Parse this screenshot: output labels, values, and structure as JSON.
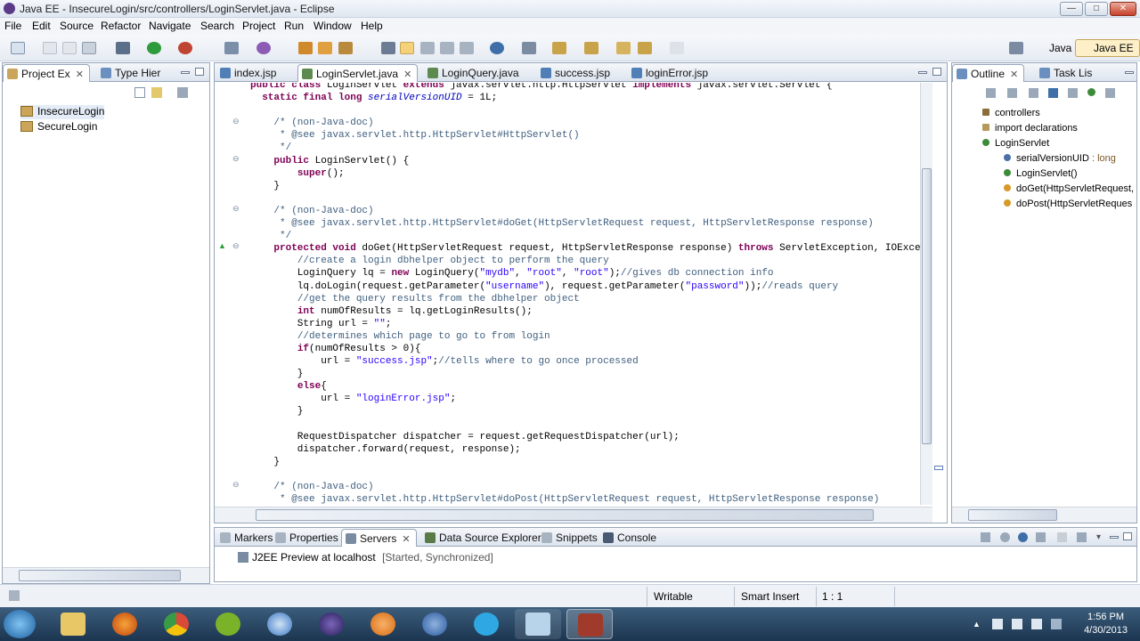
{
  "window": {
    "title": "Java EE - InsecureLogin/src/controllers/LoginServlet.java - Eclipse",
    "min": "—",
    "max": "□",
    "close": "✕"
  },
  "menu": [
    "File",
    "Edit",
    "Source",
    "Refactor",
    "Navigate",
    "Search",
    "Project",
    "Run",
    "Window",
    "Help"
  ],
  "perspectives": [
    {
      "label": "Java",
      "active": false
    },
    {
      "label": "Java EE",
      "active": true
    }
  ],
  "left_panel": {
    "tabs": [
      {
        "label": "Project Ex"
      },
      {
        "label": "Type Hier"
      }
    ],
    "projects": [
      "InsecureLogin",
      "SecureLogin"
    ]
  },
  "editor": {
    "tabs": [
      {
        "label": "index.jsp"
      },
      {
        "label": "LoginServlet.java"
      },
      {
        "label": "LoginQuery.java"
      },
      {
        "label": "success.jsp"
      },
      {
        "label": "loginError.jsp"
      }
    ],
    "selected_tab": 1
  },
  "outline": {
    "tabs": [
      {
        "label": "Outline"
      },
      {
        "label": "Task Lis"
      }
    ],
    "items": [
      {
        "label": "controllers",
        "indent": 0,
        "icon": "package-icon"
      },
      {
        "label": "import declarations",
        "indent": 0,
        "icon": "import-icon"
      },
      {
        "label": "LoginServlet",
        "indent": 0,
        "icon": "class-icon"
      },
      {
        "label": "serialVersionUID : long",
        "indent": 1,
        "icon": "field-icon"
      },
      {
        "label": "LoginServlet()",
        "indent": 1,
        "icon": "constructor-icon"
      },
      {
        "label": "doGet(HttpServletRequest,",
        "indent": 1,
        "icon": "method-icon"
      },
      {
        "label": "doPost(HttpServletReques",
        "indent": 1,
        "icon": "method-icon"
      }
    ]
  },
  "bottom_panel": {
    "tabs": [
      {
        "label": "Markers"
      },
      {
        "label": "Properties"
      },
      {
        "label": "Servers"
      },
      {
        "label": "Data Source Explorer"
      },
      {
        "label": "Snippets"
      },
      {
        "label": "Console"
      }
    ],
    "selected_tab": 2,
    "server_name": "J2EE Preview at localhost",
    "server_status": "[Started, Synchronized]"
  },
  "status": {
    "writable": "Writable",
    "insert": "Smart Insert",
    "position": "1 : 1"
  },
  "taskbar": {
    "time": "1:56 PM",
    "date": "4/30/2013"
  },
  "colors": {
    "keyword": "#7f0055",
    "comment": "#3f5f7f",
    "string": "#2a00ff",
    "field": "#0000c0"
  }
}
